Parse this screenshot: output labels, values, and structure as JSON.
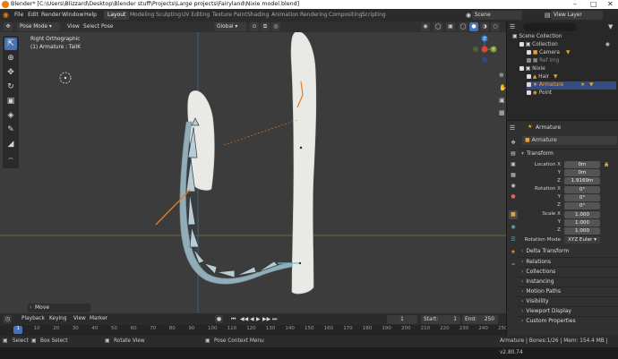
{
  "window": {
    "title": "Blender* [C:\\Users\\Blizzard\\Desktop\\Blender stuff\\Projects\\Large projects\\Fairyland\\Nixie model.blend]"
  },
  "menu": [
    "File",
    "Edit",
    "Render",
    "Window",
    "Help"
  ],
  "workspaces": [
    "Layout",
    "Modeling",
    "Sculpting",
    "UV Editing",
    "Texture Paint",
    "Shading",
    "Animation",
    "Rendering",
    "Compositing",
    "Scripting"
  ],
  "scene": "Scene",
  "view_layer": "View Layer",
  "viewport": {
    "mode": "Pose Mode",
    "menus": [
      "View",
      "Select",
      "Pose"
    ],
    "orientation": "Global",
    "info_line1": "Right Orthographic",
    "info_line2": "(1) Armature : TailK",
    "gizmo": {
      "z": "Z",
      "y": "Y"
    },
    "last_op": "Move"
  },
  "outliner": {
    "rows": [
      {
        "label": "Scene Collection"
      },
      {
        "label": "Collection"
      },
      {
        "label": "Camera"
      },
      {
        "label": "Ref img"
      },
      {
        "label": "Nixie"
      },
      {
        "label": "Hair"
      },
      {
        "label": "Armature"
      },
      {
        "label": "Point"
      }
    ]
  },
  "properties": {
    "object_name": "Armature",
    "data_name": "Armature",
    "transform_label": "Transform",
    "location": {
      "label": "Location X",
      "x": "0m",
      "y": "0m",
      "z": "1.9169m"
    },
    "rotation": {
      "label": "Rotation X",
      "x": "0°",
      "y": "0°",
      "z": "0°"
    },
    "scale": {
      "label": "Scale X",
      "x": "1.000",
      "y": "1.000",
      "z": "1.000"
    },
    "axis": {
      "y": "Y",
      "z": "Z"
    },
    "rotation_mode_label": "Rotation Mode",
    "rotation_mode": "XYZ Euler",
    "delta": "Delta Transform",
    "panels": [
      "Relations",
      "Collections",
      "Instancing",
      "Motion Paths",
      "Visibility",
      "Viewport Display",
      "Custom Properties"
    ]
  },
  "timeline": {
    "menus": [
      "Playback",
      "Keying",
      "View",
      "Marker"
    ],
    "current_frame": "1",
    "start_label": "Start:",
    "start": "1",
    "end_label": "End:",
    "end": "250",
    "ticks": [
      "1",
      "10",
      "20",
      "30",
      "40",
      "50",
      "60",
      "70",
      "80",
      "90",
      "100",
      "110",
      "120",
      "130",
      "140",
      "150",
      "160",
      "170",
      "180",
      "190",
      "200",
      "210",
      "220",
      "230",
      "240",
      "250"
    ]
  },
  "statusbar": {
    "select": "Select",
    "box_select": "Box Select",
    "rotate_view": "Rotate View",
    "context_menu": "Pose Context Menu",
    "stats": "Armature | Bones:1/26 | Mem: 154.4 MB | v2.80.74"
  },
  "colors": {
    "accent": "#4772b3",
    "orange": "#e07b28",
    "teal": "#5ec8d0",
    "bone": "#9db3bf"
  }
}
